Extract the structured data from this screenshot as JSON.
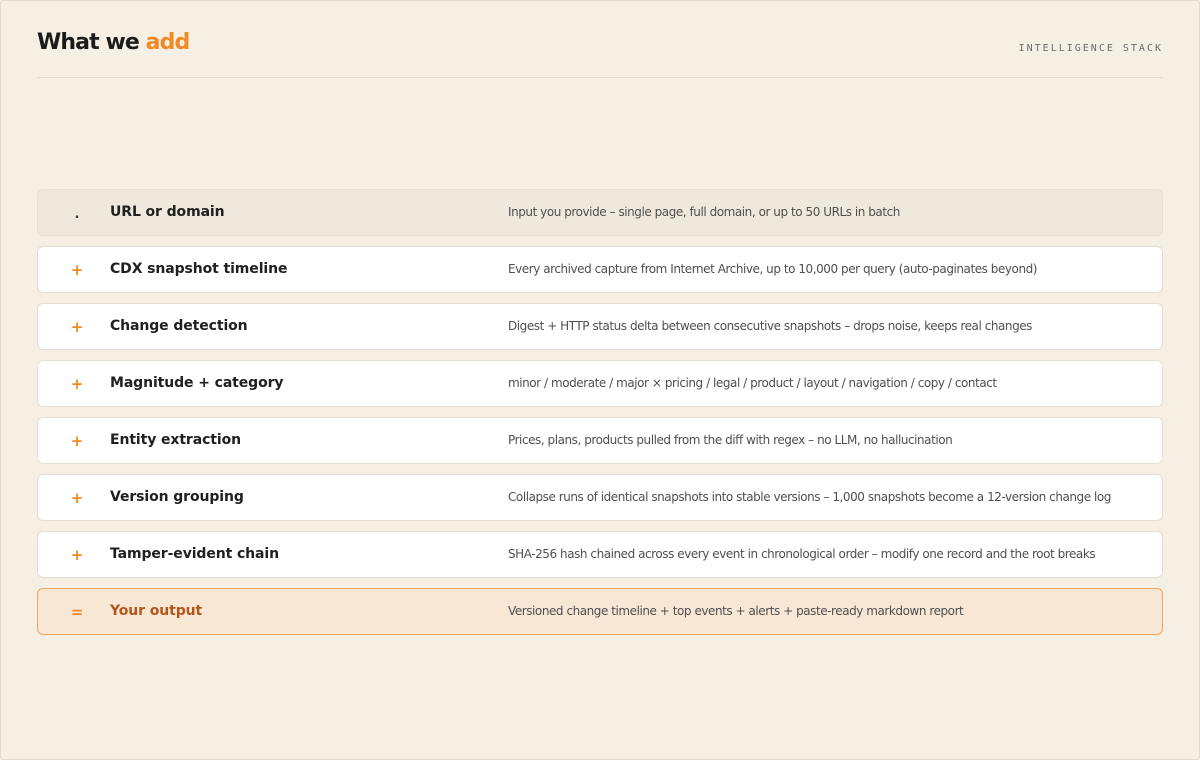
{
  "header": {
    "title_main": "What we",
    "title_accent": "add",
    "kicker": "INTELLIGENCE STACK"
  },
  "colors": {
    "background": "#f5efe4",
    "accent": "#f08a24",
    "output_text": "#b3561a",
    "output_bg": "#f9e7d6"
  },
  "rows": [
    {
      "symbol": ".",
      "label": "URL or domain",
      "desc": "Input you provide – single page, full domain, or up to 50 URLs in batch"
    },
    {
      "symbol": "+",
      "label": "CDX snapshot timeline",
      "desc": "Every archived capture from Internet Archive, up to 10,000 per query (auto-paginates beyond)"
    },
    {
      "symbol": "+",
      "label": "Change detection",
      "desc": "Digest + HTTP status delta between consecutive snapshots – drops noise, keeps real changes"
    },
    {
      "symbol": "+",
      "label": "Magnitude + category",
      "desc": "minor / moderate / major × pricing / legal / product / layout / navigation / copy / contact"
    },
    {
      "symbol": "+",
      "label": "Entity extraction",
      "desc": "Prices, plans, products pulled from the diff with regex – no LLM, no hallucination"
    },
    {
      "symbol": "+",
      "label": "Version grouping",
      "desc": "Collapse runs of identical snapshots into stable versions – 1,000 snapshots become a 12-version change log"
    },
    {
      "symbol": "+",
      "label": "Tamper-evident chain",
      "desc": "SHA-256 hash chained across every event in chronological order – modify one record and the root breaks"
    },
    {
      "symbol": "=",
      "label": "Your output",
      "desc": "Versioned change timeline + top events + alerts + paste-ready markdown report"
    }
  ]
}
